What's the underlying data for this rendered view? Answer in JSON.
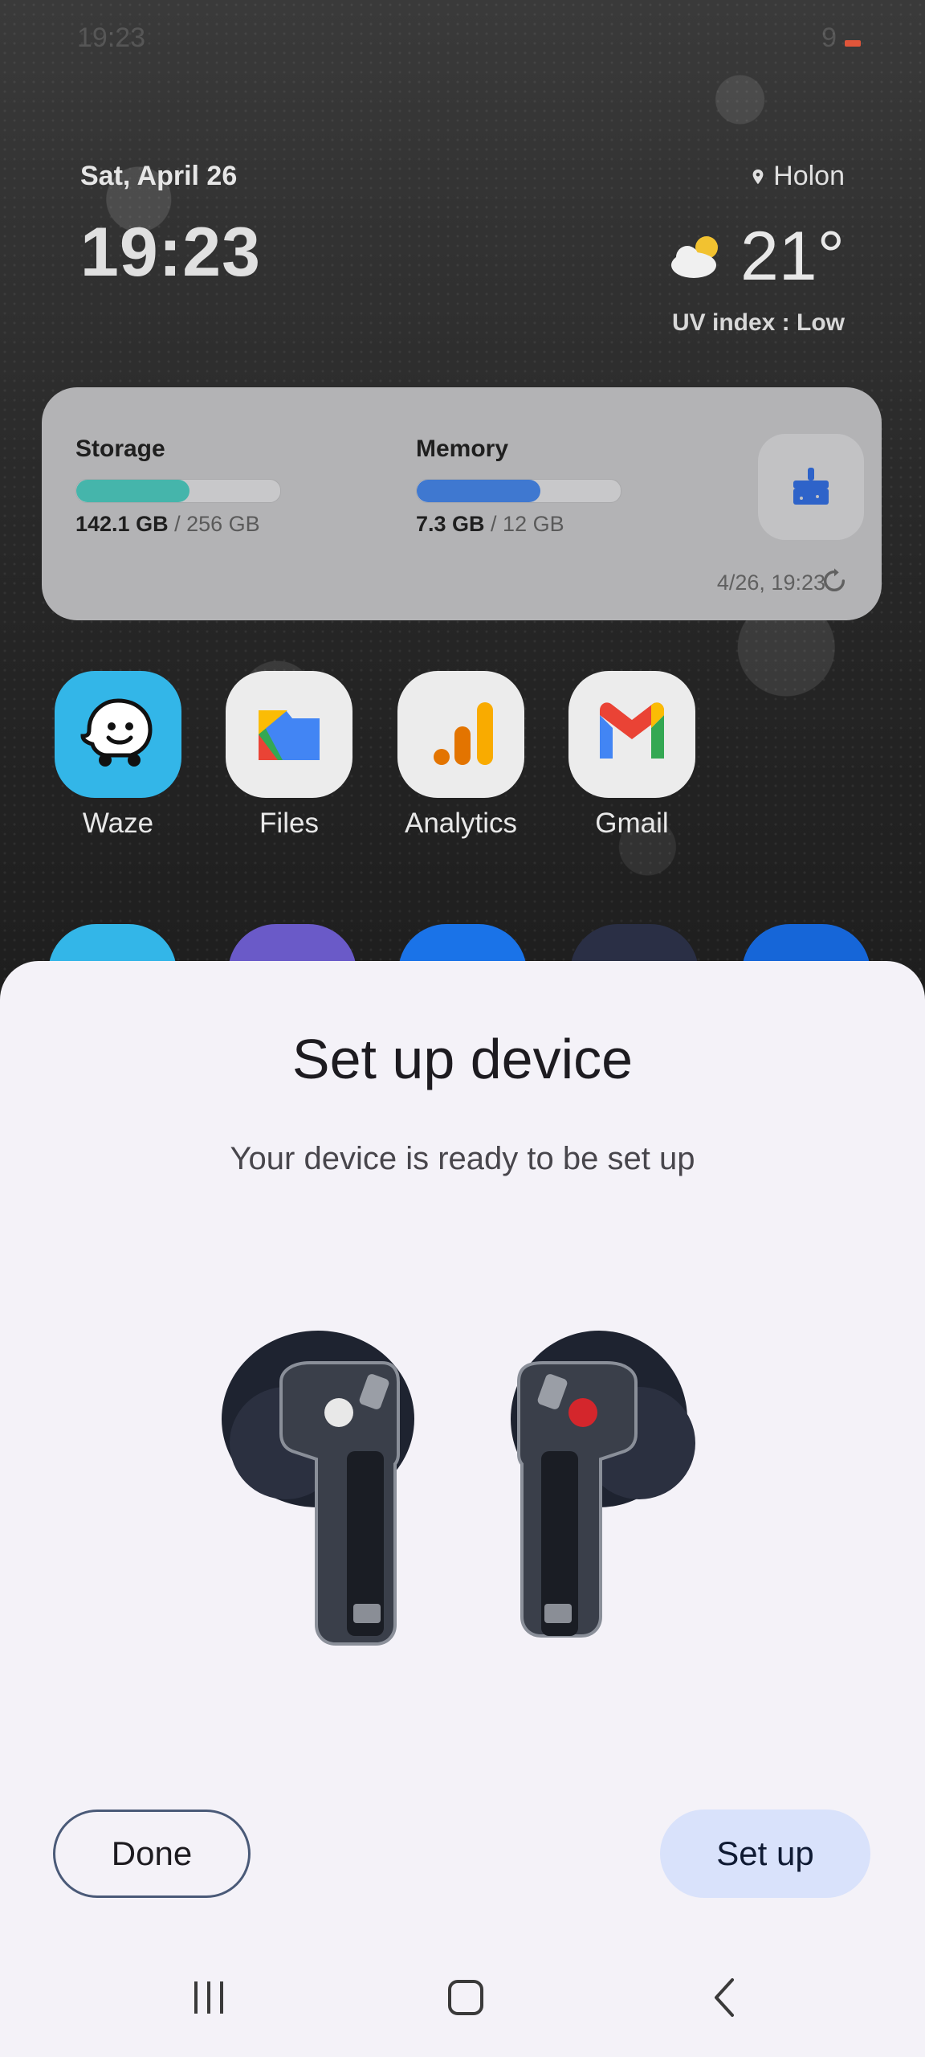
{
  "status_bar": {
    "time": "19:23",
    "battery": "9"
  },
  "home": {
    "date": "Sat, April 26",
    "clock": "19:23",
    "location": "Holon",
    "temperature": "21°",
    "uv": "UV index : Low"
  },
  "widget": {
    "storage_label": "Storage",
    "storage_used": "142.1 GB",
    "storage_total": " / 256 GB",
    "storage_fraction": 0.555,
    "memory_label": "Memory",
    "memory_used": "7.3 GB",
    "memory_total": " / 12 GB",
    "memory_fraction": 0.608,
    "updated": "4/26, 19:23",
    "colors": {
      "storage": "#45b5ab",
      "memory": "#3f78d0"
    }
  },
  "apps": [
    {
      "name": "Waze"
    },
    {
      "name": "Files"
    },
    {
      "name": "Analytics"
    },
    {
      "name": "Gmail"
    }
  ],
  "sheet": {
    "title": "Set up device",
    "subtitle": "Your device is ready to be set up",
    "done_label": "Done",
    "setup_label": "Set up"
  }
}
